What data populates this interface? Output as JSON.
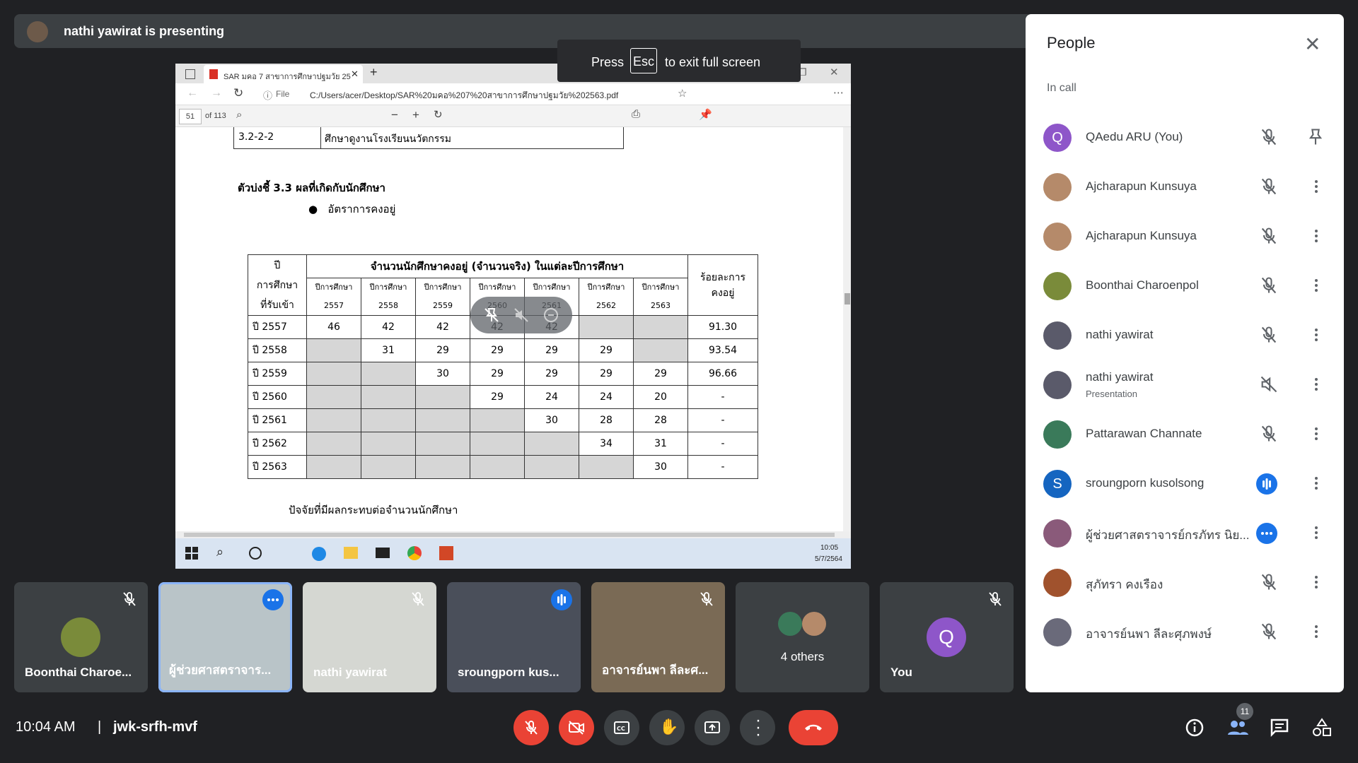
{
  "presenting": {
    "text": "nathi yawirat is presenting"
  },
  "fullscreen_hint": {
    "press": "Press",
    "key": "Esc",
    "rest": "to exit full screen"
  },
  "browser": {
    "tab_title": "SAR มคอ 7 สาขาการศึกษาปฐมวัย 25",
    "url": "C:/Users/acer/Desktop/SAR%20มคอ%207%20สาขาการศึกษาปฐมวัย%202563.pdf",
    "file_label": "File",
    "page_number": "51",
    "page_total": "of 113",
    "clock_time": "10:05",
    "clock_date": "5/7/2564"
  },
  "document": {
    "top_row_code": "3.2-2-2",
    "top_row_text": "ศึกษาดูงานโรงเรียนนวัตกรรม",
    "indicator_heading": "ตัวบ่งชี้ 3.3 ผลที่เกิดกับนักศึกษา",
    "bullet": "อัตราการคงอยู่",
    "table": {
      "year_header": [
        "ปี",
        "การศึกษา",
        "ที่รับเข้า"
      ],
      "group_header": "จำนวนนักศึกษาคงอยู่ (จำนวนจริง) ในแต่ละปีการศึกษา",
      "col_prefix": "ปีการศึกษา",
      "columns": [
        "2557",
        "2558",
        "2559",
        "2560",
        "2561",
        "2562",
        "2563"
      ],
      "pct_header": [
        "ร้อยละการ",
        "คงอยู่"
      ],
      "rows": [
        {
          "year": "ปี 2557",
          "cells": [
            "46",
            "42",
            "42",
            "42",
            "42",
            "",
            ""
          ],
          "pct": "91.30"
        },
        {
          "year": "ปี 2558",
          "cells": [
            "",
            "31",
            "29",
            "29",
            "29",
            "29",
            ""
          ],
          "pct": "93.54"
        },
        {
          "year": "ปี 2559",
          "cells": [
            "",
            "",
            "30",
            "29",
            "29",
            "29",
            "29"
          ],
          "pct": "96.66"
        },
        {
          "year": "ปี 2560",
          "cells": [
            "",
            "",
            "",
            "29",
            "24",
            "24",
            "20"
          ],
          "pct": "-"
        },
        {
          "year": "ปี 2561",
          "cells": [
            "",
            "",
            "",
            "",
            "30",
            "28",
            "28"
          ],
          "pct": "-"
        },
        {
          "year": "ปี 2562",
          "cells": [
            "",
            "",
            "",
            "",
            "",
            "34",
            "31"
          ],
          "pct": "-"
        },
        {
          "year": "ปี 2563",
          "cells": [
            "",
            "",
            "",
            "",
            "",
            "",
            "30"
          ],
          "pct": "-"
        }
      ]
    },
    "footer_text": "ปัจจัยที่มีผลกระทบต่อจำนวนนักศึกษา"
  },
  "people_panel": {
    "title": "People",
    "section": "In call",
    "participants": [
      {
        "initial": "Q",
        "name": "QAedu ARU (You)",
        "sub": "",
        "color": "#8e56c9",
        "status": "muted"
      },
      {
        "initial": "",
        "name": "Ajcharapun Kunsuya",
        "sub": "",
        "color": "#b58a6a",
        "status": "muted"
      },
      {
        "initial": "",
        "name": "Ajcharapun Kunsuya",
        "sub": "",
        "color": "#b58a6a",
        "status": "muted"
      },
      {
        "initial": "",
        "name": "Boonthai Charoenpol",
        "sub": "",
        "color": "#7a8b3a",
        "status": "muted"
      },
      {
        "initial": "",
        "name": "nathi yawirat",
        "sub": "",
        "color": "#5a5a6a",
        "status": "muted"
      },
      {
        "initial": "",
        "name": "nathi yawirat",
        "sub": "Presentation",
        "color": "#5a5a6a",
        "status": "audio-off"
      },
      {
        "initial": "",
        "name": "Pattarawan Channate",
        "sub": "",
        "color": "#3a7a5a",
        "status": "muted"
      },
      {
        "initial": "S",
        "name": "sroungporn kusolsong",
        "sub": "",
        "color": "#1565c0",
        "status": "speaking"
      },
      {
        "initial": "",
        "name": "ผู้ช่วยศาสตราจารย์กรภัทร นิย...",
        "sub": "",
        "color": "#8a5a7a",
        "status": "more"
      },
      {
        "initial": "",
        "name": "สุภัทรา คงเรือง",
        "sub": "",
        "color": "#a0522d",
        "status": "muted"
      },
      {
        "initial": "",
        "name": "อาจารย์นพา ลีละศุภพงษ์",
        "sub": "",
        "color": "#6a6a7a",
        "status": "muted"
      }
    ]
  },
  "tiles": [
    {
      "name": "Boonthai Charoe...",
      "status": "muted"
    },
    {
      "name": "ผู้ช่วยศาสตราจาร...",
      "status": "more"
    },
    {
      "name": "nathi yawirat",
      "status": "muted"
    },
    {
      "name": "sroungporn kus...",
      "status": "speaking"
    },
    {
      "name": "อาจารย์นพา ลีละศ...",
      "status": "muted"
    },
    {
      "name": "4 others",
      "status": "none"
    },
    {
      "name": "You",
      "initial": "Q",
      "status": "muted"
    }
  ],
  "bottom_bar": {
    "time": "10:04 AM",
    "separator": "|",
    "meeting_code": "jwk-srfh-mvf",
    "participant_count": "11"
  }
}
